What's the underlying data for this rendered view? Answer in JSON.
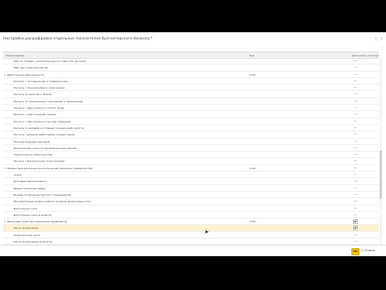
{
  "window": {
    "title": "Настройка расшифровки отдельных показателей бухгалтерского баланса *",
    "controls": [
      "⋮",
      "□",
      "×"
    ]
  },
  "toolbar": {
    "more": "⋮"
  },
  "table": {
    "columns": [
      "Наименование",
      "Код",
      "Дополнять отступом"
    ],
    "rows": [
      {
        "name": "НДС по товарам, реализованным по ставке 0% (экспорт)",
        "code": "",
        "indent": 2,
        "expander": "",
        "mark": "flag",
        "selected": false
      },
      {
        "name": "НДС при строительстве ОС",
        "code": "",
        "indent": 2,
        "expander": "",
        "mark": "flag",
        "selected": false
      },
      {
        "name": "Дебиторская задолженность",
        "code": "1230",
        "indent": 1,
        "expander": "⊖",
        "mark": "flag",
        "selected": false
      },
      {
        "name": "Расчеты с поставщиками и подрядчиками",
        "code": "",
        "indent": 2,
        "expander": "",
        "mark": "flag",
        "selected": false
      },
      {
        "name": "Расчеты с покупателями и заказчиками",
        "code": "",
        "indent": 2,
        "expander": "",
        "mark": "flag",
        "selected": false
      },
      {
        "name": "Расчеты по налогам и сборам",
        "code": "",
        "indent": 2,
        "expander": "",
        "mark": "flag",
        "selected": false
      },
      {
        "name": "Расчеты по социальному страхованию и обеспечению",
        "code": "",
        "indent": 2,
        "expander": "",
        "mark": "flag",
        "selected": false
      },
      {
        "name": "Расчеты с персоналом по оплате труда",
        "code": "",
        "indent": 2,
        "expander": "",
        "mark": "flag",
        "selected": false
      },
      {
        "name": "Расчеты с подотчетными лицами",
        "code": "",
        "indent": 2,
        "expander": "",
        "mark": "flag",
        "selected": false
      },
      {
        "name": "Расчеты с персоналом по прочим операциям",
        "code": "",
        "indent": 2,
        "expander": "",
        "mark": "flag",
        "selected": false
      },
      {
        "name": "Расчеты по вкладам в уставный (складочный) капитал",
        "code": "",
        "indent": 2,
        "expander": "",
        "mark": "flag",
        "selected": false
      },
      {
        "name": "Расчеты с разными дебиторами и кредиторами",
        "code": "",
        "indent": 2,
        "expander": "",
        "mark": "flag",
        "selected": false
      },
      {
        "name": "Расходы будущих периодов",
        "code": "",
        "indent": 2,
        "expander": "",
        "mark": "flag",
        "selected": false
      },
      {
        "name": "Выполненные этапы по незавершенным работам",
        "code": "",
        "indent": 2,
        "expander": "",
        "mark": "flag",
        "selected": false
      },
      {
        "name": "Сомнительные обязательства",
        "code": "",
        "indent": 2,
        "expander": "",
        "mark": "flag",
        "selected": false
      },
      {
        "name": "Расчеты с фактическими получателями",
        "code": "",
        "indent": 2,
        "expander": "",
        "mark": "flag",
        "selected": false
      },
      {
        "name": "Финансовые вложения (за исключением денежных эквивалентов)",
        "code": "1240",
        "indent": 1,
        "expander": "⊖",
        "mark": "flag",
        "selected": false
      },
      {
        "name": "Акции",
        "code": "",
        "indent": 2,
        "expander": "",
        "mark": "flag",
        "selected": false
      },
      {
        "name": "Долговые ценные бумаги",
        "code": "",
        "indent": 2,
        "expander": "",
        "mark": "flag",
        "selected": false
      },
      {
        "name": "Предоставленные займы",
        "code": "",
        "indent": 2,
        "expander": "",
        "mark": "flag",
        "selected": false
      },
      {
        "name": "Вклады по договору простого товарищества",
        "code": "",
        "indent": 2,
        "expander": "",
        "mark": "flag",
        "selected": false
      },
      {
        "name": "Приобретенные права в рамках оказания финансовых услуг",
        "code": "",
        "indent": 2,
        "expander": "",
        "mark": "flag",
        "selected": false
      },
      {
        "name": "Депозитные счета",
        "code": "",
        "indent": 2,
        "expander": "",
        "mark": "flag",
        "selected": false
      },
      {
        "name": "Депозитные счета (в валюте)",
        "code": "",
        "indent": 2,
        "expander": "",
        "mark": "flag",
        "selected": false
      },
      {
        "name": "Денежные средства и денежные эквиваленты",
        "code": "1250",
        "indent": 1,
        "expander": "⊖",
        "mark": "check-on",
        "selected": false
      },
      {
        "name": "Касса организации",
        "code": "",
        "indent": 2,
        "expander": "",
        "mark": "check-on",
        "selected": true
      },
      {
        "name": "Операционная касса",
        "code": "",
        "indent": 2,
        "expander": "",
        "mark": "flag",
        "selected": false
      },
      {
        "name": "Касса организации (в валюте)",
        "code": "",
        "indent": 2,
        "expander": "",
        "mark": "flag",
        "selected": false
      },
      {
        "name": "Касса по деятельности платежного агента",
        "code": "",
        "indent": 2,
        "expander": "",
        "mark": "flag",
        "selected": false
      },
      {
        "name": "Расчетные счета",
        "code": "",
        "indent": 2,
        "expander": "",
        "mark": "flag",
        "selected": false
      },
      {
        "name": "Валютные счета",
        "code": "",
        "indent": 2,
        "expander": "",
        "mark": "flag",
        "selected": false
      },
      {
        "name": "Аккредитивы",
        "code": "",
        "indent": 2,
        "expander": "",
        "mark": "flag",
        "selected": false
      }
    ]
  },
  "footer": {
    "ok_label": "ОК",
    "cancel_label": "✕ Отмена"
  }
}
